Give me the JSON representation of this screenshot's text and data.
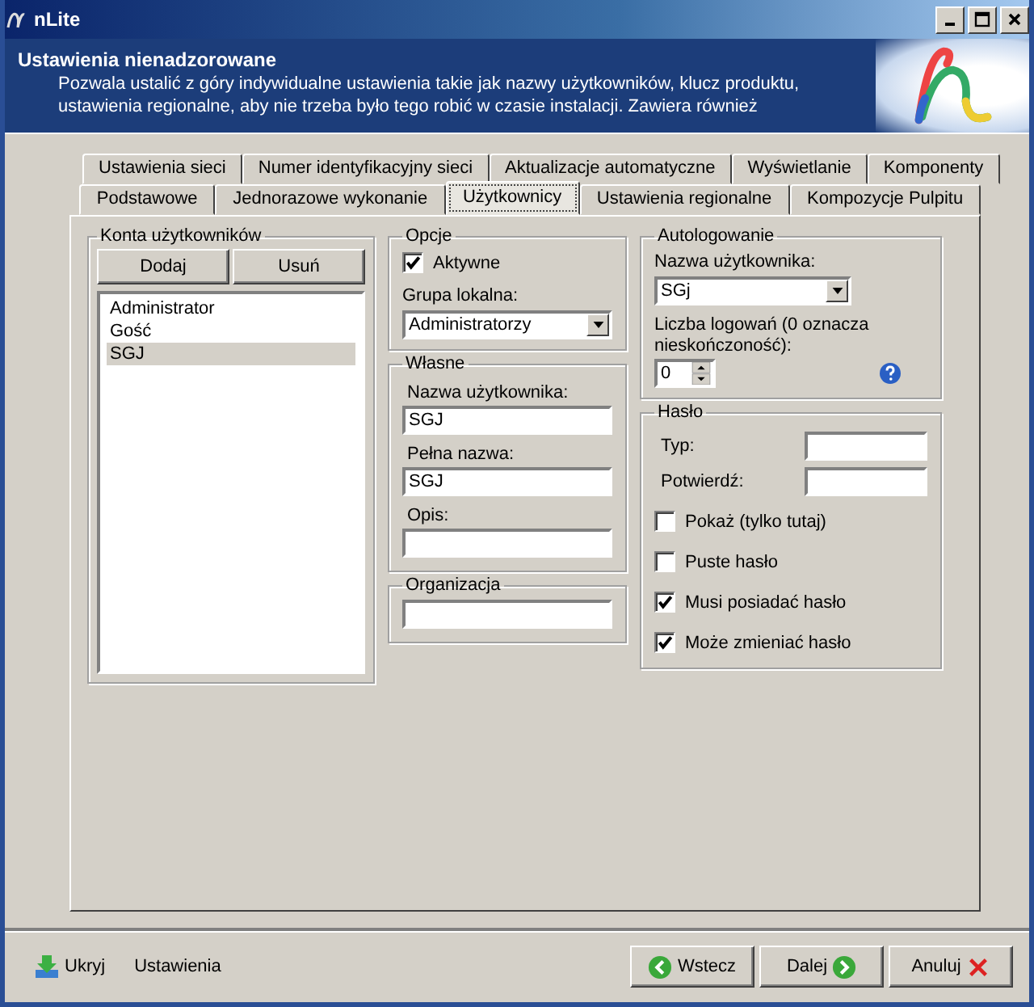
{
  "window": {
    "title": "nLite"
  },
  "header": {
    "title": "Ustawienia nienadzorowane",
    "description": "Pozwala ustalić z góry indywidualne ustawienia takie jak nazwy użytkowników, klucz produktu, ustawienia regionalne, aby nie trzeba było tego robić w czasie instalacji. Zawiera również"
  },
  "tabs": [
    [
      {
        "label": "Ustawienia sieci",
        "selected": false
      },
      {
        "label": "Numer identyfikacyjny sieci",
        "selected": false
      },
      {
        "label": "Aktualizacje automatyczne",
        "selected": false
      },
      {
        "label": "Wyświetlanie",
        "selected": false
      },
      {
        "label": "Komponenty",
        "selected": false
      }
    ],
    [
      {
        "label": "Podstawowe",
        "selected": false
      },
      {
        "label": "Jednorazowe wykonanie",
        "selected": false
      },
      {
        "label": "Użytkownicy",
        "selected": true
      },
      {
        "label": "Ustawienia regionalne",
        "selected": false
      },
      {
        "label": "Kompozycje Pulpitu",
        "selected": false
      }
    ]
  ],
  "accounts": {
    "title": "Konta użytkowników",
    "buttons": [
      "Dodaj",
      "Usuń"
    ],
    "items": [
      {
        "label": "Administrator",
        "selected": false
      },
      {
        "label": "Gość",
        "selected": false
      },
      {
        "label": "SGJ",
        "selected": true
      }
    ]
  },
  "options": {
    "title": "Opcje",
    "active": {
      "label": "Aktywne",
      "checked": true
    },
    "group_label": "Grupa lokalna:",
    "group_value": "Administratorzy"
  },
  "own": {
    "title": "Własne",
    "fields": [
      {
        "label": "Nazwa użytkownika:",
        "value": "SGJ"
      },
      {
        "label": "Pełna nazwa:",
        "value": "SGJ"
      },
      {
        "label": "Opis:"
      }
    ]
  },
  "organization": {
    "title": "Organizacja"
  },
  "autologon": {
    "title": "Autologowanie",
    "user_label": "Nazwa użytkownika:",
    "user_value": "SGj",
    "count_label": "Liczba logowań (0 oznacza nieskończoność):",
    "count_value": "0"
  },
  "password": {
    "title": "Hasło",
    "fields": [
      {
        "label": "Typ:"
      },
      {
        "label": "Potwierdź:"
      }
    ],
    "checkboxes": [
      {
        "label": "Pokaż (tylko tutaj)",
        "checked": false
      },
      {
        "label": "Puste hasło",
        "checked": false
      },
      {
        "label": "Musi posiadać hasło",
        "checked": true
      },
      {
        "label": "Może zmieniać hasło",
        "checked": true
      }
    ]
  },
  "footer": {
    "links": [
      "Ukryj",
      "Ustawienia"
    ],
    "buttons": [
      {
        "kind": "back",
        "label": "Wstecz"
      },
      {
        "kind": "next",
        "label": "Dalej"
      },
      {
        "kind": "cancel",
        "label": "Anuluj"
      }
    ]
  }
}
